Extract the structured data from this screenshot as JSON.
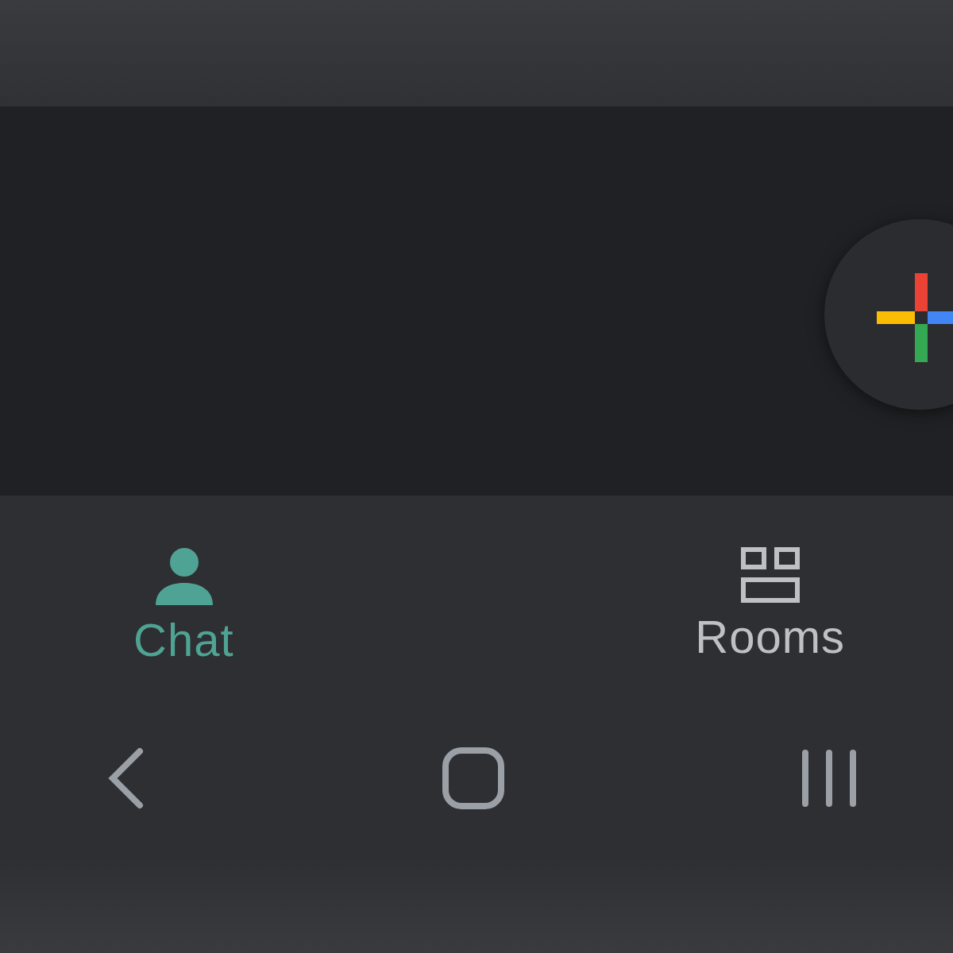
{
  "bottom_nav": {
    "tabs": [
      {
        "label": "Chat",
        "kind": "person",
        "selected": true
      },
      {
        "label": "Rooms",
        "kind": "grid",
        "selected": false
      }
    ]
  }
}
